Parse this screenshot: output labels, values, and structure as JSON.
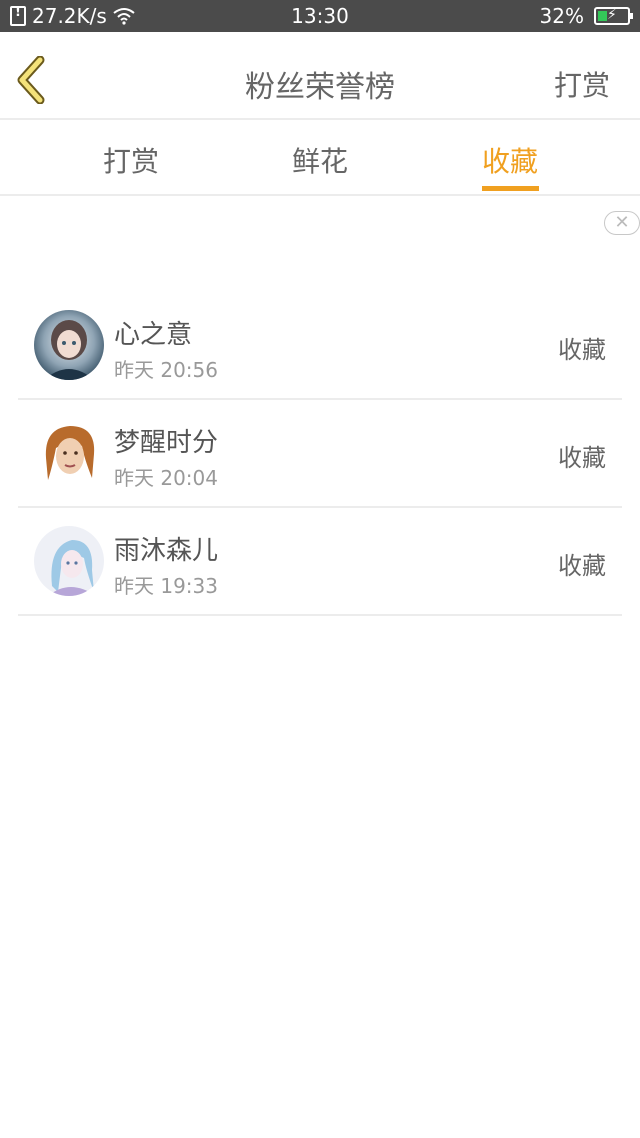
{
  "status_bar": {
    "speed": "27.2K/s",
    "time": "13:30",
    "battery": "32%",
    "battery_level": 0.32,
    "battery_color": "#34c759",
    "icons": [
      "sim-alert-icon",
      "wifi-icon",
      "battery-charging-icon"
    ]
  },
  "header": {
    "back_icon": "chevron-left-icon",
    "title": "粉丝荣誉榜",
    "right_label": "打赏"
  },
  "tabs": [
    {
      "label": "打赏",
      "active": false
    },
    {
      "label": "鲜花",
      "active": false
    },
    {
      "label": "收藏",
      "active": true
    }
  ],
  "accent_color": "#f0a020",
  "close_button": {
    "symbol": "✕"
  },
  "fans": [
    {
      "name": "心之意",
      "time": "昨天 20:56",
      "action": "收藏",
      "avatar_icon": "anime-girl-avatar"
    },
    {
      "name": "梦醒时分",
      "time": "昨天 20:04",
      "action": "收藏",
      "avatar_icon": "illustrated-face-avatar"
    },
    {
      "name": "雨沐森儿",
      "time": "昨天 19:33",
      "action": "收藏",
      "avatar_icon": "anime-blue-hair-avatar"
    }
  ]
}
